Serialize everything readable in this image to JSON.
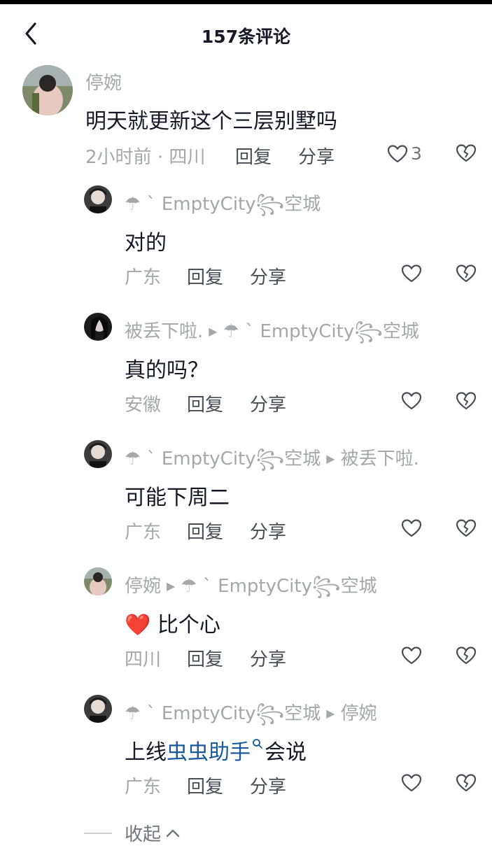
{
  "header": {
    "title": "157条评论"
  },
  "main_comment": {
    "author": "停婉",
    "text": "明天就更新这个三层别墅吗",
    "time_location": "2小时前 · 四川",
    "reply_label": "回复",
    "share_label": "分享",
    "like_count": "3"
  },
  "replies": [
    {
      "author": "☂ ˋ EmptyCity꧂空城",
      "reply_to": "",
      "text": "对的",
      "location": "广东",
      "reply_label": "回复",
      "share_label": "分享"
    },
    {
      "author": "被丢下啦.",
      "reply_to": "☂ ˋ EmptyCity꧂空城",
      "text": "真的吗？",
      "location": "安徽",
      "reply_label": "回复",
      "share_label": "分享"
    },
    {
      "author": "☂ ˋ EmptyCity꧂空城",
      "reply_to": "被丢下啦.",
      "text": "可能下周二",
      "location": "广东",
      "reply_label": "回复",
      "share_label": "分享"
    },
    {
      "author": "停婉",
      "reply_to": "☂ ˋ EmptyCity꧂空城",
      "text": "比个心",
      "emoji": "❤️",
      "location": "四川",
      "reply_label": "回复",
      "share_label": "分享"
    },
    {
      "author": "☂ ˋ EmptyCity꧂空城",
      "reply_to": "停婉",
      "text_prefix": "上线",
      "text_link": "虫虫助手",
      "text_suffix": "会说",
      "location": "广东",
      "reply_label": "回复",
      "share_label": "分享"
    }
  ],
  "collapse_label": "收起",
  "colors": {
    "meta": "#a5a7ab",
    "link": "#1a5a9c",
    "heart_red": "#e0141e"
  }
}
